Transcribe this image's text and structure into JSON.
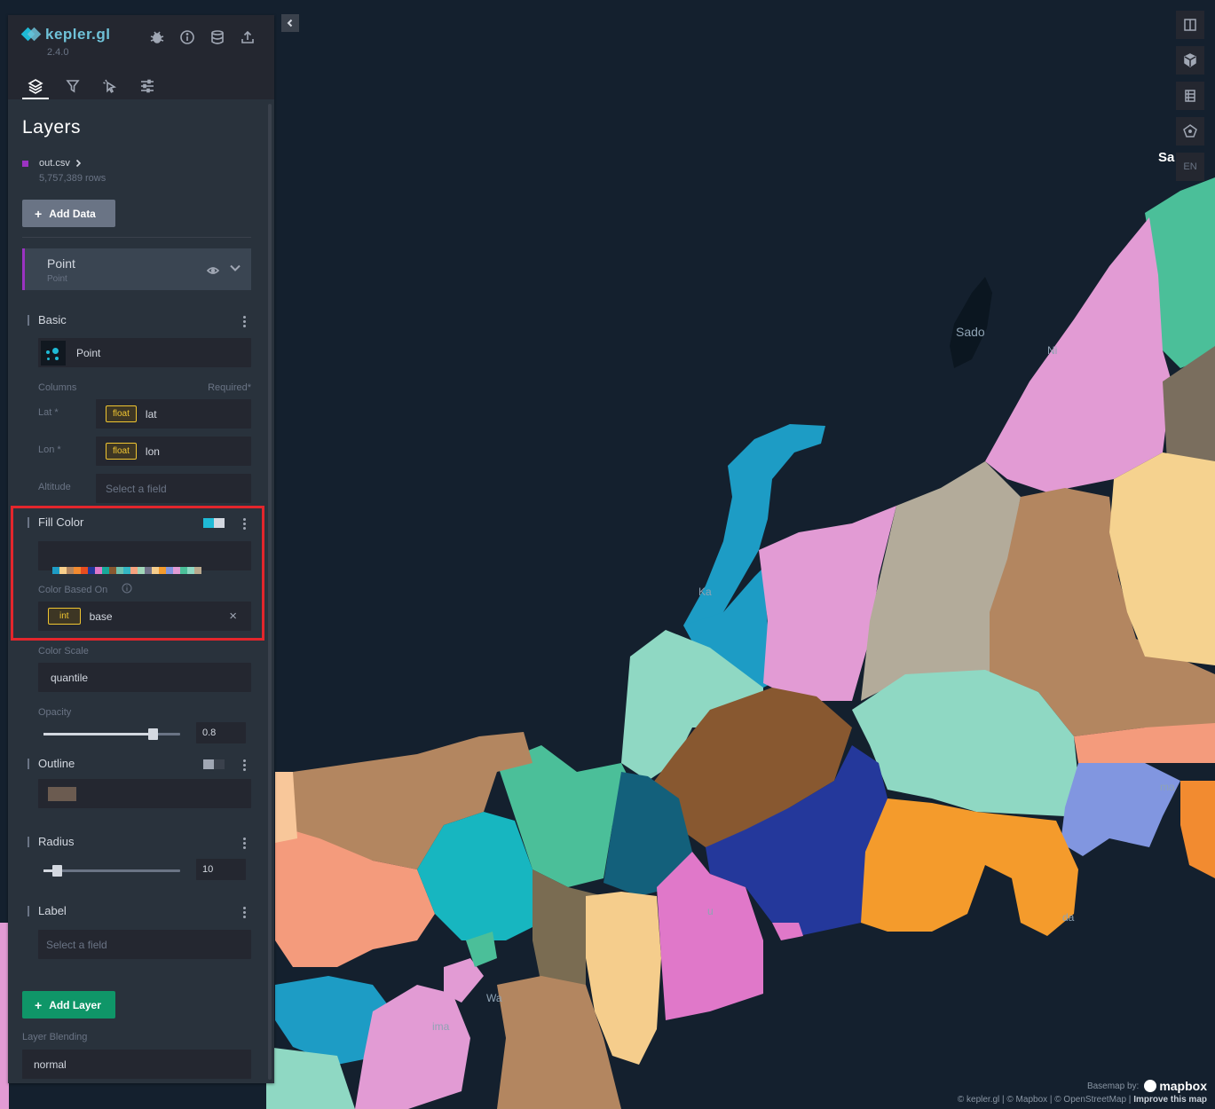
{
  "app": {
    "name": "kepler.gl",
    "version": "2.4.0"
  },
  "panel": {
    "title": "Layers"
  },
  "dataset": {
    "name": "out.csv",
    "rows": "5,757,389 rows",
    "color": "#9b33c2"
  },
  "buttons": {
    "add_data": "Add Data",
    "add_layer": "Add Layer"
  },
  "layer": {
    "name": "Point",
    "type": "Point"
  },
  "basic": {
    "title": "Basic",
    "layer_type": "Point",
    "columns_label": "Columns",
    "required_label": "Required*",
    "lat_label": "Lat *",
    "lat_type": "float",
    "lat_field": "lat",
    "lon_label": "Lon *",
    "lon_type": "float",
    "lon_field": "lon",
    "alt_label": "Altitude",
    "alt_placeholder": "Select a field"
  },
  "fill_color": {
    "title": "Fill Color",
    "based_on_label": "Color Based On",
    "field_type": "int",
    "field": "base",
    "scale_label": "Color Scale",
    "scale": "quantile",
    "opacity_label": "Opacity",
    "opacity": "0.8",
    "palette": [
      "#1d9cc5",
      "#f8cf8c",
      "#b38660",
      "#f28b30",
      "#e84d1f",
      "#24389b",
      "#e078c9",
      "#17a99a",
      "#885830",
      "#6fc3b0",
      "#34b7c4",
      "#f7a37f",
      "#a1d7b9",
      "#73738b",
      "#f5cd8c",
      "#f49b2c",
      "#8196e0",
      "#e29bd4",
      "#4bbf99",
      "#8fd8c3",
      "#b9a88d"
    ]
  },
  "outline": {
    "title": "Outline",
    "color": "#6b5b50"
  },
  "radius": {
    "title": "Radius",
    "value": "10"
  },
  "label": {
    "title": "Label",
    "placeholder": "Select a field"
  },
  "blending": {
    "label": "Layer Blending",
    "value": "normal"
  },
  "map_labels": {
    "sado": "Sado",
    "sa": "Sa",
    "ni": "Ni",
    "ka": "Ka",
    "ma": "ma",
    "wa": "Wa",
    "ima": "ima",
    "da": "da",
    "u": "u"
  },
  "map_controls": {
    "locale": "EN"
  },
  "attribution": {
    "basemap_by": "Basemap by:",
    "mapbox": "mapbox",
    "credits": "© kepler.gl | © Mapbox | © OpenStreetMap |",
    "improve": "Improve this map"
  }
}
